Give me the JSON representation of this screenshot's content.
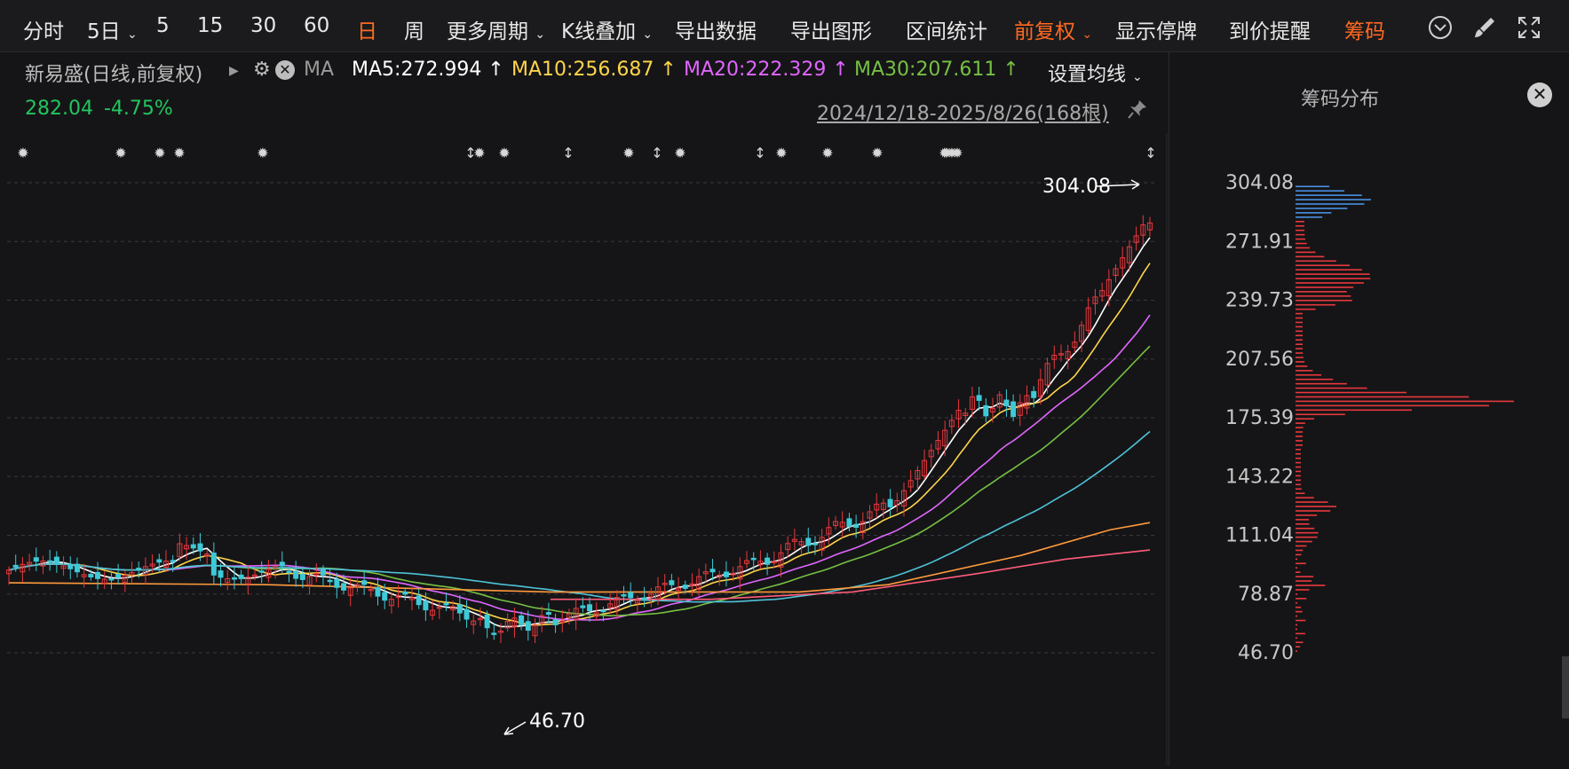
{
  "toolbar": {
    "items": [
      {
        "label": "分时"
      },
      {
        "label": "5日"
      },
      {
        "label": "5"
      },
      {
        "label": "15"
      },
      {
        "label": "30"
      },
      {
        "label": "60"
      },
      {
        "label": "日"
      },
      {
        "label": "周"
      },
      {
        "label": "更多周期"
      },
      {
        "label": "K线叠加"
      },
      {
        "label": "导出数据"
      },
      {
        "label": "导出图形"
      },
      {
        "label": "区间统计"
      },
      {
        "label": "前复权"
      },
      {
        "label": "显示停牌"
      },
      {
        "label": "到价提醒"
      },
      {
        "label": "筹码"
      }
    ],
    "active_color": "#ff6a21",
    "icons": [
      "chevron-down-circle-icon",
      "brush-icon",
      "fullscreen-icon"
    ]
  },
  "info": {
    "name": "新易盛(日线,前复权)",
    "ma_label": "MA",
    "ma5": "MA5:272.994",
    "ma10": "MA10:256.687",
    "ma20": "MA20:222.329",
    "ma30": "MA30:207.611",
    "setting": "设置均线",
    "price": "282.04",
    "change": "-4.75%",
    "range": "2024/12/18-2025/8/26(168根)"
  },
  "colors": {
    "up": "#e8383d",
    "down": "#3ec9d6",
    "ma5": "#ffffff",
    "ma10": "#ffd54a",
    "ma20": "#e066ff",
    "ma30": "#76c043",
    "ma60": "#4fc3d9",
    "ma120": "#ff9a3c",
    "ma250": "#ff5c7a",
    "chip_top": "#4a90e2",
    "chip_bottom": "#e8383d"
  },
  "chart": {
    "high_label": "304.08",
    "low_label": "46.70",
    "y_ticks": [
      "304.08",
      "271.91",
      "239.73",
      "207.56",
      "175.39",
      "143.22",
      "111.04",
      "78.87",
      "46.70"
    ]
  },
  "chip": {
    "title": "筹码分布",
    "close": "✕"
  }
}
